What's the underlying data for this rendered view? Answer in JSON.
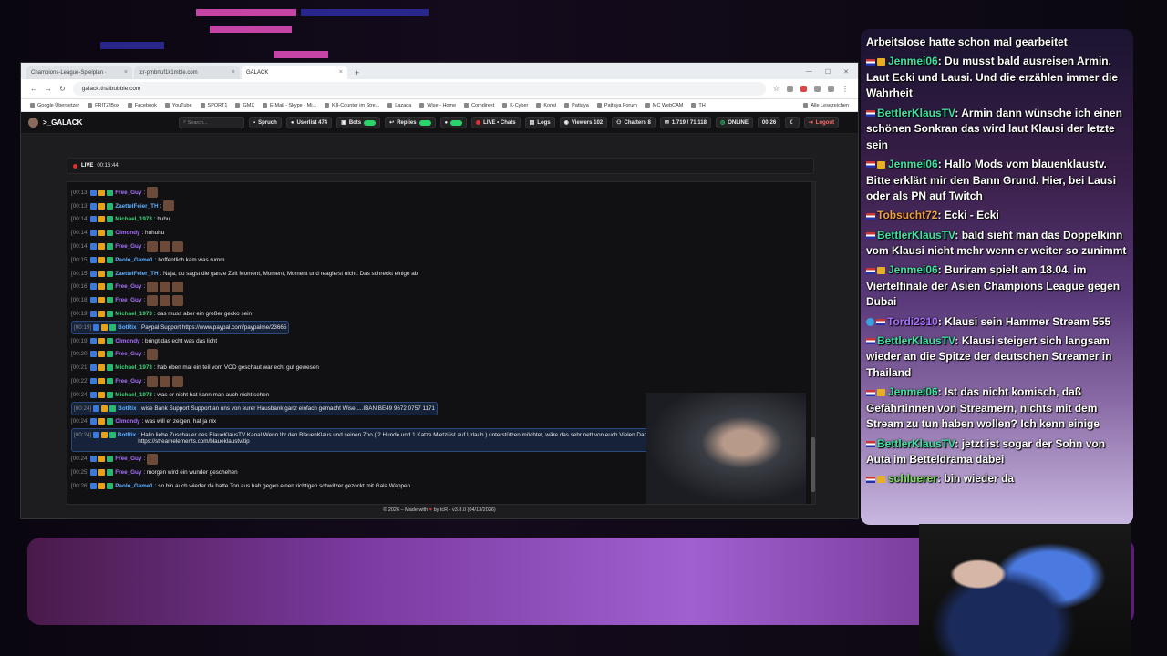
{
  "browser": {
    "tabs": [
      {
        "label": "Champions-League-Spielplan ·",
        "active": false
      },
      {
        "label": "tcr-pmbrtuf1k1mble.com",
        "active": false
      },
      {
        "label": "GALACK",
        "active": true
      }
    ],
    "new_tab": "+",
    "url": "galack.thaibubble.com",
    "bookmarks": [
      "Google Übersetzer",
      "FRITZ!Box",
      "Facebook",
      "YouTube",
      "SPORT1",
      "GMX",
      "E-Mail - Skype - Mi...",
      "Kill-Counter im Stre...",
      "Lazada",
      "Wise - Home",
      "Comdirekt",
      "K-Cyber",
      "Konsl",
      "Pattaya",
      "Pattaya Forum",
      "MC WebCAM",
      "TH"
    ],
    "all_bookmarks": "Alle Lesezeichen"
  },
  "app": {
    "logo": ">_GALACK",
    "search_placeholder": "Search...",
    "buttons": {
      "spruch": "Spruch",
      "userlist": "Userlist 474",
      "bots": "Bots",
      "replies": "Replies",
      "live_chats": "LIVE • Chats",
      "logs": "Logs",
      "viewers": "Viewers 102",
      "chatters": "Chatters 8",
      "msgs": "1.719 / 71.118",
      "online": "ONLINE",
      "time": "00:26",
      "logout": "Logout"
    },
    "live_label": "LIVE",
    "live_time": "00:16:44",
    "footer": {
      "pre": "© 2026 – Made with",
      "by": "by tcR",
      "version": "v3.8.0 (04/13/2026)"
    }
  },
  "chat": [
    {
      "time": "[00:13]",
      "user": "Free_Guy",
      "color": "#a970ff",
      "text": ":",
      "emotes": 1
    },
    {
      "time": "[00:13]",
      "user": "ZaettelFeier_TH",
      "color": "#5fb0ff",
      "text": ":",
      "emotes": 1
    },
    {
      "time": "[00:14]",
      "user": "Michael_1973",
      "color": "#3fd67a",
      "text": ": huhu"
    },
    {
      "time": "[00:14]",
      "user": "Olmondy",
      "color": "#a970ff",
      "text": ": huhuhu"
    },
    {
      "time": "[00:14]",
      "user": "Free_Guy",
      "color": "#a970ff",
      "text": ":",
      "emotes": 3
    },
    {
      "time": "[00:15]",
      "user": "Paolo_Game1",
      "color": "#5fb0ff",
      "text": ": hoffentlich kam was rumm"
    },
    {
      "time": "[00:15]",
      "user": "ZaettelFeier_TH",
      "color": "#5fb0ff",
      "text": ": Naja, du sagst die ganze Zeit Moment, Moment, Moment und reagierst nicht. Das schreckt einige ab"
    },
    {
      "time": "[00:16]",
      "user": "Free_Guy",
      "color": "#a970ff",
      "text": ":",
      "emotes": 3
    },
    {
      "time": "[00:18]",
      "user": "Free_Guy",
      "color": "#a970ff",
      "text": ":",
      "emotes": 3
    },
    {
      "time": "[00:19]",
      "user": "Michael_1973",
      "color": "#3fd67a",
      "text": ": das muss aber ein großer gecko sein"
    },
    {
      "time": "[00:19]",
      "user": "BotRix",
      "color": "#5fb0ff",
      "text": ": Paypal Support https://www.paypal.com/paypalme/23665",
      "hl": true
    },
    {
      "time": "[00:19]",
      "user": "Olmondy",
      "color": "#a970ff",
      "text": ": bringt das echt was das licht"
    },
    {
      "time": "[00:20]",
      "user": "Free_Guy",
      "color": "#a970ff",
      "text": ":",
      "emotes": 1
    },
    {
      "time": "[00:21]",
      "user": "Michael_1973",
      "color": "#3fd67a",
      "text": ": hab eben mal ein teil vom VOD geschaut war echt gut gewesen"
    },
    {
      "time": "[00:22]",
      "user": "Free_Guy",
      "color": "#a970ff",
      "text": ":",
      "emotes": 3
    },
    {
      "time": "[00:24]",
      "user": "Michael_1973",
      "color": "#3fd67a",
      "text": ": was er nicht hat kann man auch nicht sehen"
    },
    {
      "time": "[00:24]",
      "user": "BotRix",
      "color": "#5fb0ff",
      "text": ": wise Bank Support Support an uns von eurer Hausbank ganz einfach gemacht Wise.....IBAN BE49 9672 0757 1171",
      "hl": true
    },
    {
      "time": "[00:24]",
      "user": "Olmondy",
      "color": "#a970ff",
      "text": ": was will er zeigen, hat ja nix"
    },
    {
      "time": "[00:24]",
      "user": "BotRix",
      "color": "#5fb0ff",
      "text": ": Hallo liebe Zuschauer des BlaueKlausTV Kanal.Wenn Ihr den BlauenKlaus und seinen Zoo ( 2 Hunde und 1 Katze Mietzi ist auf Urlaub ) unterstützen möchtet, wäre das sehr nett von euch Vielen Dank vom BlauenKlaus https://streamelements.com/blaueklaustv/tip",
      "hl": true,
      "tall": true
    },
    {
      "time": "[00:24]",
      "user": "Free_Guy",
      "color": "#a970ff",
      "text": ":",
      "emotes": 1
    },
    {
      "time": "[00:25]",
      "user": "Free_Guy",
      "color": "#a970ff",
      "text": ": morgen wird ein wunder geschehen"
    },
    {
      "time": "[00:26]",
      "user": "Paolo_Game1",
      "color": "#5fb0ff",
      "text": ": so bin auch wieder da hatte Ton aus hab gegen einen richtigen schwitzer gezockt mit Gala Wappen"
    }
  ],
  "side_chat": [
    {
      "user": "",
      "color": "#fff",
      "text": "Arbeitslose hatte schon mal gearbeitet",
      "badges": "none"
    },
    {
      "user": "Jenmei06",
      "color": "#3fe0a0",
      "text": ": Du musst bald ausreisen Armin. Laut Ecki und Lausi. Und die erzählen immer die Wahrheit",
      "badges": "flagcrown"
    },
    {
      "user": "BettlerKlausTV",
      "color": "#3fe0a0",
      "text": ": Armin dann wünsche ich einen schönen Sonkran das wird laut Klausi der letzte sein",
      "badges": "flag"
    },
    {
      "user": "Jenmei06",
      "color": "#3fe0a0",
      "text": ": Hallo Mods vom blauenklaustv. Bitte erklärt mir den Bann Grund. Hier, bei Lausi oder als PN auf Twitch",
      "badges": "flagcrown"
    },
    {
      "user": "Tobsucht72",
      "color": "#f0a040",
      "text": ": Ecki - Ecki",
      "badges": "flag"
    },
    {
      "user": "BettlerKlausTV",
      "color": "#3fe0a0",
      "text": ": bald sieht man das Doppelkinn vom Klausi nicht mehr wenn er weiter so zunimmt",
      "badges": "flag"
    },
    {
      "user": "Jenmei06",
      "color": "#3fe0a0",
      "text": ": Buriram spielt am 18.04. im Viertelfinale der Asien Champions League gegen Dubai",
      "badges": "flagcrown"
    },
    {
      "user": "Tordi2310",
      "color": "#a970ff",
      "text": ": Klausi sein Hammer Stream 555",
      "badges": "globeflag"
    },
    {
      "user": "BettlerKlausTV",
      "color": "#3fe0a0",
      "text": ": Klausi steigert sich langsam wieder an die Spitze der deutschen Streamer in Thailand",
      "badges": "flag"
    },
    {
      "user": "Jenmei06",
      "color": "#3fe0a0",
      "text": ": Ist das nicht komisch, daß Gefährtinnen von Streamern, nichts mit dem Stream zu tun haben wollen? Ich kenn einige",
      "badges": "flagcrown"
    },
    {
      "user": "BettlerKlausTV",
      "color": "#3fe0a0",
      "text": ": jetzt ist sogar der Sohn von Auta im Betteldrama dabei",
      "badges": "flag"
    },
    {
      "user": "schluerer",
      "color": "#7fe060",
      "text": ": bin wieder da",
      "badges": "flagcrown"
    }
  ]
}
